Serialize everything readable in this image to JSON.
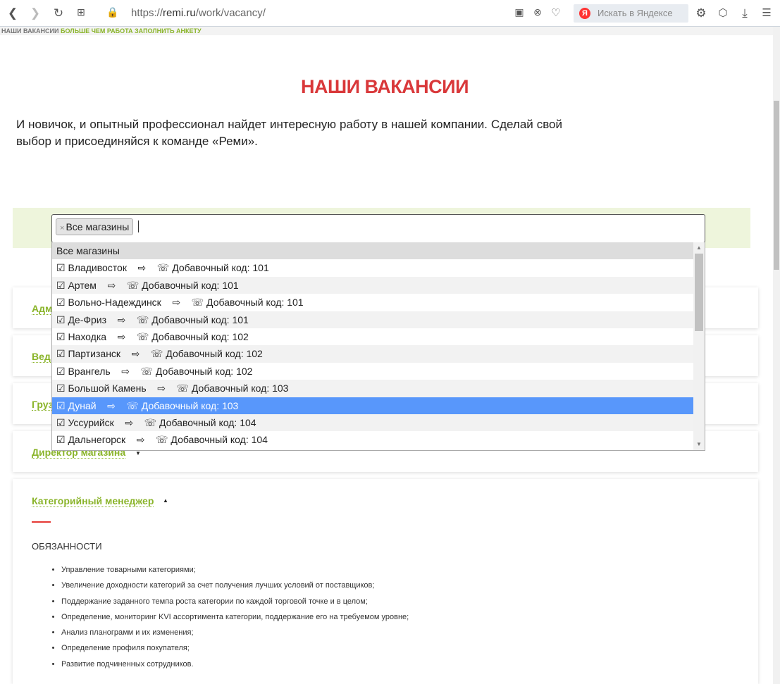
{
  "browser": {
    "url_prefix": "https://",
    "url_domain": "remi.ru",
    "url_path": "/work/vacancy/",
    "search_placeholder": "Искать в Яндексе"
  },
  "top_strip": {
    "item1": "НАШИ ВАКАНСИИ",
    "item2": "БОЛЬШЕ ЧЕМ РАБОТА",
    "item3": "ЗАПОЛНИТЬ АНКЕТУ"
  },
  "title": "НАШИ ВАКАНСИИ",
  "intro": "И новичок, и опытный профессионал найдет интересную работу в нашей компании. Сделай свой выбор и присоединяйся к команде «Реми».",
  "filter": {
    "chip": "Все магазины",
    "chip_remove": "×",
    "options": [
      {
        "label": "Все магазины"
      },
      {
        "label": "☑ Владивосток    ⇨    ☏ Добавочный код: 101"
      },
      {
        "label": "☑ Артем    ⇨    ☏ Добавочный код: 101"
      },
      {
        "label": "☑ Вольно-Надеждинск    ⇨    ☏ Добавочный код: 101"
      },
      {
        "label": "☑ Де-Фриз    ⇨    ☏ Добавочный код: 101"
      },
      {
        "label": "☑ Находка    ⇨    ☏ Добавочный код: 102"
      },
      {
        "label": "☑ Партизанск    ⇨    ☏ Добавочный код: 102"
      },
      {
        "label": "☑ Врангель    ⇨    ☏ Добавочный код: 102"
      },
      {
        "label": "☑ Большой Камень    ⇨    ☏ Добавочный код: 103"
      },
      {
        "label": "☑ Дунай    ⇨    ☏ Добавочный код: 103"
      },
      {
        "label": "☑ Уссурийск    ⇨    ☏ Добавочный код: 104"
      },
      {
        "label": "☑ Дальнегорск    ⇨    ☏ Добавочный код: 104"
      }
    ]
  },
  "vacancies": [
    {
      "title": "Адм"
    },
    {
      "title": "Вед"
    },
    {
      "title": "Груз"
    },
    {
      "title": "Директор магазина"
    },
    {
      "title": "Категорийный менеджер"
    }
  ],
  "details": {
    "heading": "ОБЯЗАННОСТИ",
    "items": [
      "Управление товарными категориями;",
      "Увеличение доходности категорий за счет получения лучших условий от поставщиков;",
      "Поддержание заданного темпа роста категории по каждой торговой точке и в целом;",
      "Определение, мониторинг KVI ассортимента категории, поддержание его на требуемом уровне;",
      "Анализ планограмм и их изменения;",
      "Определение профиля покупателя;",
      "Развитие подчиненных сотрудников."
    ]
  }
}
